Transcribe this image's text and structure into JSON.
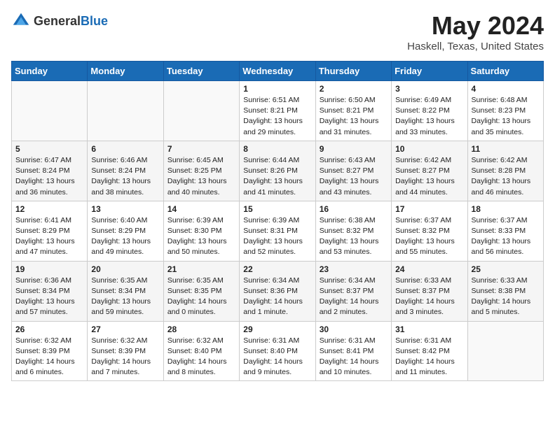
{
  "logo": {
    "general": "General",
    "blue": "Blue"
  },
  "title": {
    "month": "May 2024",
    "location": "Haskell, Texas, United States"
  },
  "headers": [
    "Sunday",
    "Monday",
    "Tuesday",
    "Wednesday",
    "Thursday",
    "Friday",
    "Saturday"
  ],
  "weeks": [
    [
      {
        "day": "",
        "info": ""
      },
      {
        "day": "",
        "info": ""
      },
      {
        "day": "",
        "info": ""
      },
      {
        "day": "1",
        "info": "Sunrise: 6:51 AM\nSunset: 8:21 PM\nDaylight: 13 hours\nand 29 minutes."
      },
      {
        "day": "2",
        "info": "Sunrise: 6:50 AM\nSunset: 8:21 PM\nDaylight: 13 hours\nand 31 minutes."
      },
      {
        "day": "3",
        "info": "Sunrise: 6:49 AM\nSunset: 8:22 PM\nDaylight: 13 hours\nand 33 minutes."
      },
      {
        "day": "4",
        "info": "Sunrise: 6:48 AM\nSunset: 8:23 PM\nDaylight: 13 hours\nand 35 minutes."
      }
    ],
    [
      {
        "day": "5",
        "info": "Sunrise: 6:47 AM\nSunset: 8:24 PM\nDaylight: 13 hours\nand 36 minutes."
      },
      {
        "day": "6",
        "info": "Sunrise: 6:46 AM\nSunset: 8:24 PM\nDaylight: 13 hours\nand 38 minutes."
      },
      {
        "day": "7",
        "info": "Sunrise: 6:45 AM\nSunset: 8:25 PM\nDaylight: 13 hours\nand 40 minutes."
      },
      {
        "day": "8",
        "info": "Sunrise: 6:44 AM\nSunset: 8:26 PM\nDaylight: 13 hours\nand 41 minutes."
      },
      {
        "day": "9",
        "info": "Sunrise: 6:43 AM\nSunset: 8:27 PM\nDaylight: 13 hours\nand 43 minutes."
      },
      {
        "day": "10",
        "info": "Sunrise: 6:42 AM\nSunset: 8:27 PM\nDaylight: 13 hours\nand 44 minutes."
      },
      {
        "day": "11",
        "info": "Sunrise: 6:42 AM\nSunset: 8:28 PM\nDaylight: 13 hours\nand 46 minutes."
      }
    ],
    [
      {
        "day": "12",
        "info": "Sunrise: 6:41 AM\nSunset: 8:29 PM\nDaylight: 13 hours\nand 47 minutes."
      },
      {
        "day": "13",
        "info": "Sunrise: 6:40 AM\nSunset: 8:29 PM\nDaylight: 13 hours\nand 49 minutes."
      },
      {
        "day": "14",
        "info": "Sunrise: 6:39 AM\nSunset: 8:30 PM\nDaylight: 13 hours\nand 50 minutes."
      },
      {
        "day": "15",
        "info": "Sunrise: 6:39 AM\nSunset: 8:31 PM\nDaylight: 13 hours\nand 52 minutes."
      },
      {
        "day": "16",
        "info": "Sunrise: 6:38 AM\nSunset: 8:32 PM\nDaylight: 13 hours\nand 53 minutes."
      },
      {
        "day": "17",
        "info": "Sunrise: 6:37 AM\nSunset: 8:32 PM\nDaylight: 13 hours\nand 55 minutes."
      },
      {
        "day": "18",
        "info": "Sunrise: 6:37 AM\nSunset: 8:33 PM\nDaylight: 13 hours\nand 56 minutes."
      }
    ],
    [
      {
        "day": "19",
        "info": "Sunrise: 6:36 AM\nSunset: 8:34 PM\nDaylight: 13 hours\nand 57 minutes."
      },
      {
        "day": "20",
        "info": "Sunrise: 6:35 AM\nSunset: 8:34 PM\nDaylight: 13 hours\nand 59 minutes."
      },
      {
        "day": "21",
        "info": "Sunrise: 6:35 AM\nSunset: 8:35 PM\nDaylight: 14 hours\nand 0 minutes."
      },
      {
        "day": "22",
        "info": "Sunrise: 6:34 AM\nSunset: 8:36 PM\nDaylight: 14 hours\nand 1 minute."
      },
      {
        "day": "23",
        "info": "Sunrise: 6:34 AM\nSunset: 8:37 PM\nDaylight: 14 hours\nand 2 minutes."
      },
      {
        "day": "24",
        "info": "Sunrise: 6:33 AM\nSunset: 8:37 PM\nDaylight: 14 hours\nand 3 minutes."
      },
      {
        "day": "25",
        "info": "Sunrise: 6:33 AM\nSunset: 8:38 PM\nDaylight: 14 hours\nand 5 minutes."
      }
    ],
    [
      {
        "day": "26",
        "info": "Sunrise: 6:32 AM\nSunset: 8:39 PM\nDaylight: 14 hours\nand 6 minutes."
      },
      {
        "day": "27",
        "info": "Sunrise: 6:32 AM\nSunset: 8:39 PM\nDaylight: 14 hours\nand 7 minutes."
      },
      {
        "day": "28",
        "info": "Sunrise: 6:32 AM\nSunset: 8:40 PM\nDaylight: 14 hours\nand 8 minutes."
      },
      {
        "day": "29",
        "info": "Sunrise: 6:31 AM\nSunset: 8:40 PM\nDaylight: 14 hours\nand 9 minutes."
      },
      {
        "day": "30",
        "info": "Sunrise: 6:31 AM\nSunset: 8:41 PM\nDaylight: 14 hours\nand 10 minutes."
      },
      {
        "day": "31",
        "info": "Sunrise: 6:31 AM\nSunset: 8:42 PM\nDaylight: 14 hours\nand 11 minutes."
      },
      {
        "day": "",
        "info": ""
      }
    ]
  ]
}
